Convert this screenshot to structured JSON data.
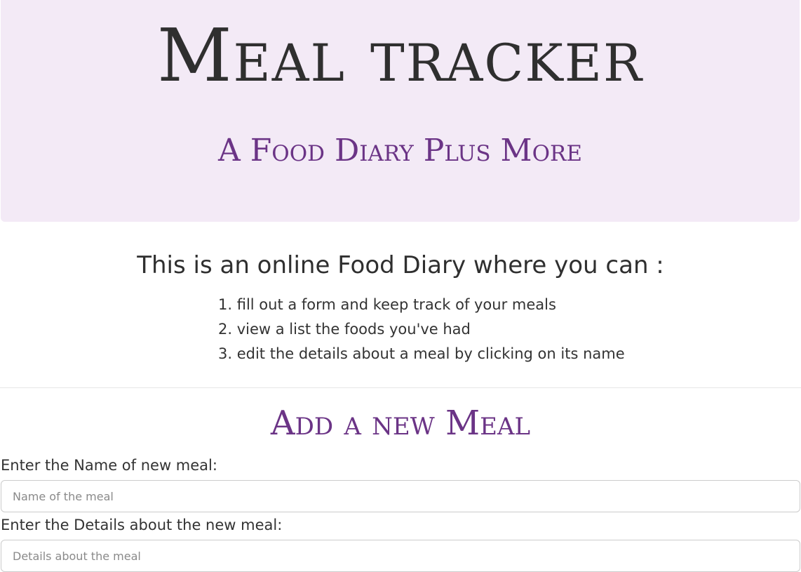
{
  "header": {
    "title": "Meal tracker",
    "subtitle": "A Food Diary Plus More"
  },
  "intro": {
    "heading": "This is an online Food Diary where you can :",
    "items": [
      "1. fill out a form and keep track of your meals",
      "2. view a list the foods you've had",
      "3. edit the details about a meal by clicking on its name"
    ]
  },
  "form": {
    "heading": "Add a new Meal",
    "name_label": "Enter the Name of new meal:",
    "name_placeholder": "Name of the meal",
    "details_label": "Enter the Details about the new meal:",
    "details_placeholder": "Details about the meal"
  },
  "colors": {
    "header_background": "#f3eaf6",
    "accent": "#6b3486",
    "title_text": "#2f2f2f"
  }
}
